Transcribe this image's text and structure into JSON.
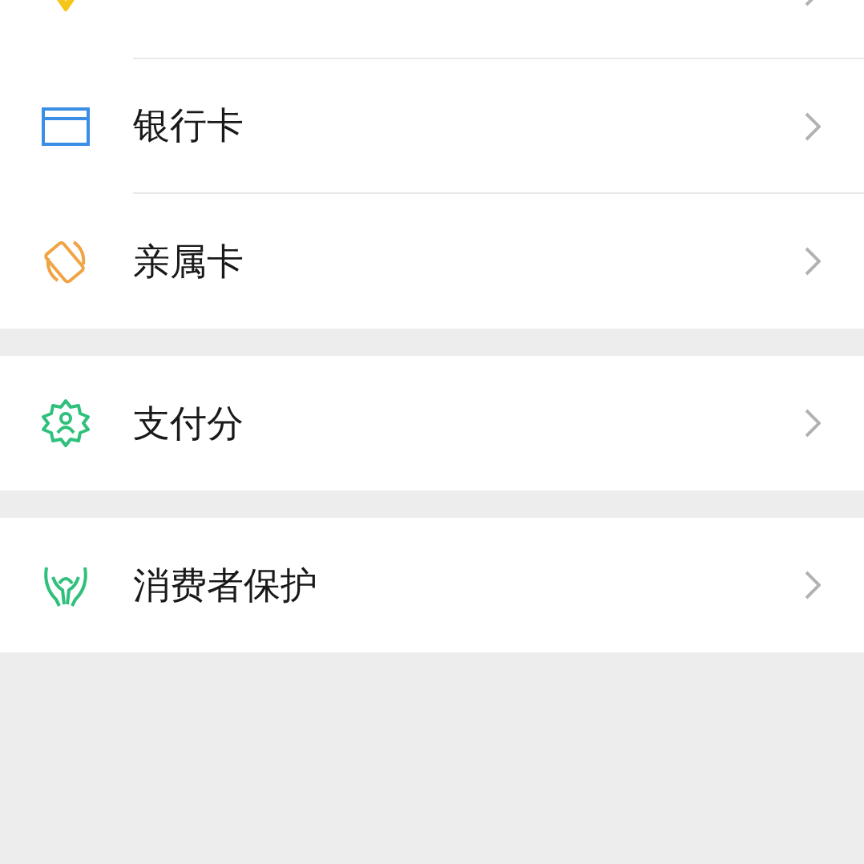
{
  "groups": [
    {
      "items": [
        {
          "kind": "wallet"
        },
        {
          "kind": "bank",
          "label": "银行卡"
        },
        {
          "kind": "family",
          "label": "亲属卡"
        }
      ]
    },
    {
      "items": [
        {
          "kind": "score",
          "label": "支付分"
        }
      ]
    },
    {
      "items": [
        {
          "kind": "protect",
          "label": "消费者保护"
        }
      ]
    }
  ]
}
